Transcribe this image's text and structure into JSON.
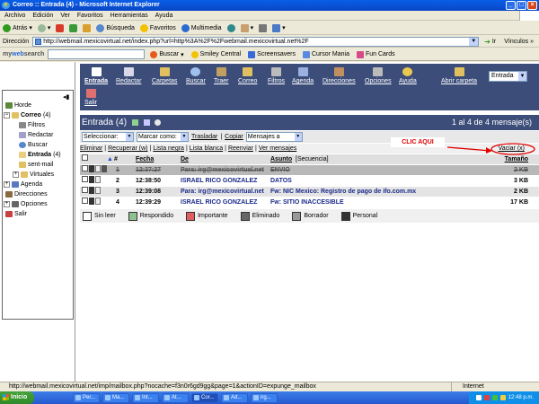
{
  "window": {
    "title": "Correo :: Entrada (4) - Microsoft Internet Explorer"
  },
  "menu": [
    "Archivo",
    "Edición",
    "Ver",
    "Favoritos",
    "Herramientas",
    "Ayuda"
  ],
  "toolbar": {
    "back": "Atrás",
    "search": "Búsqueda",
    "favorites": "Favoritos",
    "multimedia": "Multimedia"
  },
  "address": {
    "label": "Dirección",
    "url": "http://webmail.mexicovirtual.net/index.php?url=http%3A%2F%2Fwebmail.mexicovirtual.net%2F",
    "go": "Ir",
    "links": "Vínculos"
  },
  "websearch": {
    "logo_my": "my",
    "logo_web": "web",
    "logo_search": "search",
    "buscar": "Buscar",
    "buttons": [
      "Smiley Central",
      "Screensavers",
      "Cursor Mania",
      "Fun Cards"
    ]
  },
  "sidebar": {
    "items": [
      {
        "label": "Horde",
        "count": ""
      },
      {
        "label": "Correo",
        "count": "(4)"
      },
      {
        "label": "Filtros",
        "count": ""
      },
      {
        "label": "Redactar",
        "count": ""
      },
      {
        "label": "Buscar",
        "count": ""
      },
      {
        "label": "Entrada",
        "count": "(4)"
      },
      {
        "label": "sent-mail",
        "count": ""
      },
      {
        "label": "Virtuales",
        "count": ""
      },
      {
        "label": "Agenda",
        "count": ""
      },
      {
        "label": "Direcciones",
        "count": ""
      },
      {
        "label": "Opciones",
        "count": ""
      },
      {
        "label": "Salir",
        "count": ""
      }
    ]
  },
  "nav": {
    "items": [
      "Entrada",
      "Redactar",
      "Carpetas",
      "Buscar",
      "Traer",
      "Correo",
      "Filtros",
      "Agenda",
      "Direcciones",
      "Opciones",
      "Ayuda",
      "Abrir carpeta"
    ],
    "salir": "Salir",
    "folder_select": "Entrada"
  },
  "mailbox": {
    "title": "Entrada (4)",
    "count": "1 al 4 de 4 mensaje(s)",
    "select1": "Seleccionar:",
    "select2": "Marcar como:",
    "trasladar": "Trasladar",
    "copiar": "Copiar",
    "select3": "Mensajes a",
    "actions": [
      "Eliminar",
      "Recuperar (w)",
      "Lista negra",
      "Lista blanca",
      "Reenviar",
      "Ver mensajes"
    ],
    "vaciar": "Vaciar (x)",
    "columns": {
      "num": "#",
      "date": "Fecha",
      "from": "De",
      "subject": "Asunto",
      "sequence": "[Secuencia]",
      "size": "Tamaño"
    },
    "rows": [
      {
        "num": "1",
        "date": "12:37:27",
        "from": "Para: irg@mexicovirtual.net",
        "subject": "ENVIO",
        "size": "2 KB"
      },
      {
        "num": "2",
        "date": "12:38:50",
        "from": "ISRAEL RICO GONZALEZ",
        "subject": "DATOS",
        "size": "3 KB"
      },
      {
        "num": "3",
        "date": "12:39:08",
        "from": "Para: irg@mexicovirtual.net",
        "subject": "Fw: NIC Mexico: Registro de pago de ifo.com.mx",
        "size": "2 KB"
      },
      {
        "num": "4",
        "date": "12:39:29",
        "from": "ISRAEL RICO GONZALEZ",
        "subject": "Fw: SITIO INACCESIBLE",
        "size": "17 KB"
      }
    ],
    "legend": [
      "Sin leer",
      "Respondido",
      "Importante",
      "Eliminado",
      "Borrador",
      "Personal"
    ]
  },
  "annotation": {
    "text": "CLIC AQUI"
  },
  "status": {
    "url": "http://webmail.mexicovirtual.net/imp/mailbox.php?nocache=f3n0r6gd9gg&page=1&actionID=expunge_mailbox",
    "zone": "Internet"
  },
  "taskbar": {
    "start": "Inicio",
    "tasks": [
      "Per...",
      "Ma...",
      "Int...",
      "At...",
      "Cor...",
      "Ad...",
      "irg..."
    ],
    "clock": "12:48 p.m."
  }
}
